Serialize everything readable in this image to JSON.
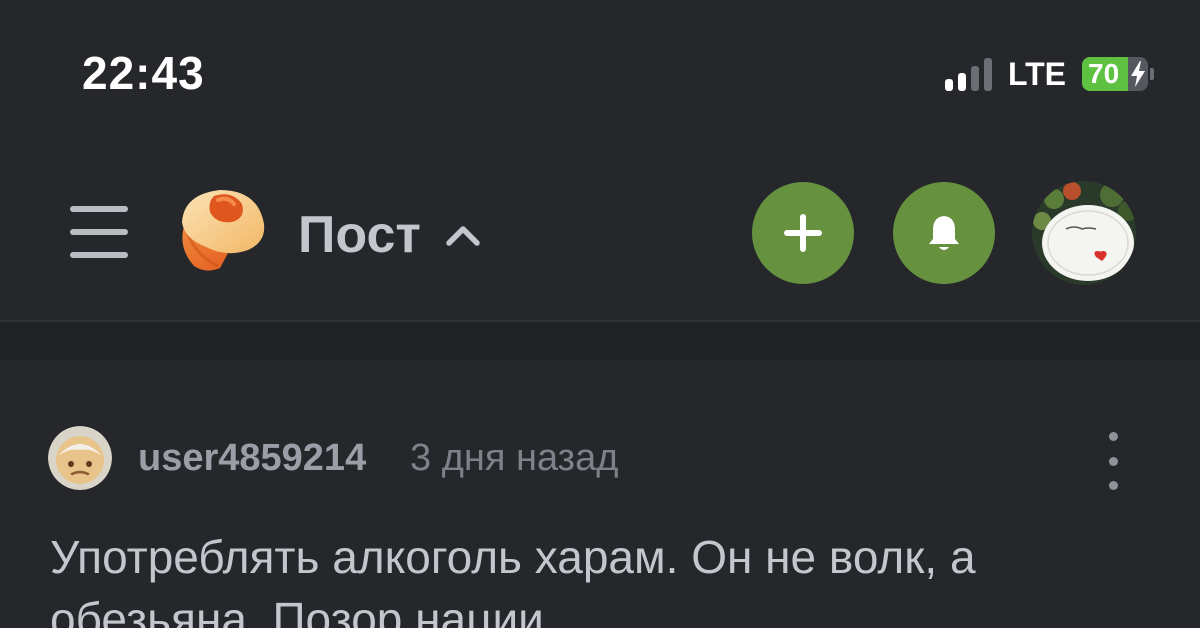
{
  "status_bar": {
    "time": "22:43",
    "network": "LTE",
    "battery": 70,
    "battery_label": "70",
    "battery_charging": true,
    "signal_bars_active": 2,
    "signal_bars_total": 4
  },
  "header": {
    "title": "Пост",
    "menu_icon": "hamburger-menu-icon",
    "logo_icon": "cupcake-logo-icon",
    "title_chevron_icon": "chevron-up-icon",
    "add_icon": "plus-icon",
    "notification_icon": "bell-icon",
    "accent_color": "#66913f"
  },
  "comment": {
    "username": "user4859214",
    "time_ago": "3 дня назад",
    "text": "Употреблять алкоголь харам. Он не волк, а обезьяна. Позор нации",
    "more_icon": "more-vertical-icon"
  }
}
